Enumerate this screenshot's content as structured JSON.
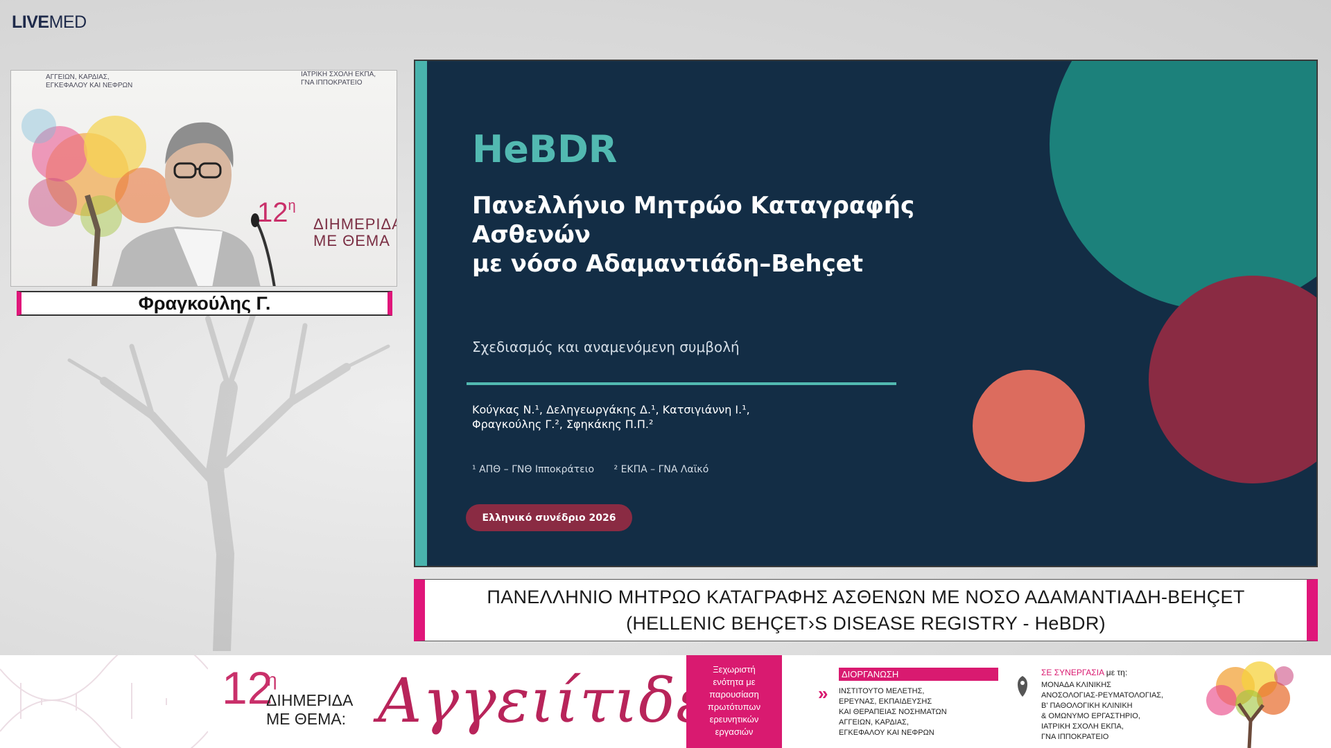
{
  "logo": {
    "bold": "LIVE",
    "light": "MED"
  },
  "video": {
    "org_left": [
      "ΑΓΓΕΙΩΝ, ΚΑΡΔΙΑΣ,",
      "ΕΓΚΕΦΑΛΟΥ ΚΑΙ ΝΕΦΡΩΝ"
    ],
    "org_right": [
      "ΙΑΤΡΙΚΗ ΣΧΟΛΗ ΕΚΠΑ,",
      "ΓΝΑ ΙΠΠΟΚΡΑΤΕΙΟ"
    ],
    "banner_num": "12",
    "banner_sup": "η",
    "banner_lines": [
      "ΔΙΗΜΕΡΙΔΑ",
      "ΜΕ ΘΕΜΑ"
    ]
  },
  "speaker": {
    "name": "Φραγκούλης Γ."
  },
  "slide": {
    "acronym": "HeBDR",
    "title_lines": [
      "Πανελλήνιο Μητρώο Καταγραφής",
      "Ασθενών",
      "με νόσο Αδαμαντιάδη–Behçet"
    ],
    "subtitle": "Σχεδιασμός και αναμενόμενη συμβολή",
    "authors_lines": [
      "Κούγκας Ν.¹, Δεληγεωργάκης Δ.¹, Κατσιγιάννη Ι.¹,",
      "Φραγκούλης Γ.², Σφηκάκης Π.Π.²"
    ],
    "affiliations": [
      "¹ ΑΠΘ – ΓΝΘ Ιπποκράτειο",
      "² ΕΚΠΑ – ΓΝΑ Λαϊκό"
    ],
    "badge": "Ελληνικό συνέδριο 2026",
    "colors": {
      "background": "#132d45",
      "teal": "#52b9b1",
      "maroon": "#8a2b43",
      "coral": "#dc6c5e"
    }
  },
  "caption": {
    "line1": "ΠΑΝΕΛΛΗΝΙΟ ΜΗΤΡΩΟ ΚΑΤΑΓΡΑΦΗΣ ΑΣΘΕΝΩΝ ΜΕ ΝΟΣΟ ΑΔΑΜΑΝΤΙΑΔΗ-BEHÇET",
    "line2": "(HELLENIC BEHÇET›S DISEASE REGISTRY - HeBDR)"
  },
  "banner": {
    "num": "12",
    "sup": "η",
    "lines": [
      "ΔΙΗΜΕΡΙΔΑ",
      "ΜΕ ΘΕΜΑ:"
    ],
    "script_title": "Αγγειίτιδες",
    "pink_box": [
      "Ξεχωριστή",
      "ενότητα με",
      "παρουσίαση",
      "πρωτότυπων",
      "ερευνητικών",
      "εργασιών"
    ],
    "organizer_head": "ΔΙΟΡΓΑΝΩΣΗ",
    "organizer_lines": [
      "ΙΝΣΤΙΤΟΥΤΟ ΜΕΛΕΤΗΣ,",
      "ΕΡΕΥΝΑΣ, ΕΚΠΑΙΔΕΥΣΗΣ",
      "ΚΑΙ ΘΕΡΑΠΕΙΑΣ ΝΟΣΗΜΑΤΩΝ",
      "ΑΓΓΕΙΩΝ, ΚΑΡΔΙΑΣ,",
      "ΕΓΚΕΦΑΛΟΥ ΚΑΙ ΝΕΦΡΩΝ"
    ],
    "collab_head": "ΣΕ ΣΥΝΕΡΓΑΣΙΑ",
    "collab_head_small": " με τη:",
    "collab_lines": [
      "ΜΟΝΑΔΑ ΚΛΙΝΙΚΗΣ",
      "ΑΝΟΣΟΛΟΓΙΑΣ-ΡΕΥΜΑΤΟΛΟΓΙΑΣ,",
      "Β' ΠΑΘΟΛΟΓΙΚΗ ΚΛΙΝΙΚΗ",
      "& ΟΜΩΝΥΜΟ ΕΡΓΑΣΤΗΡΙΟ,",
      "ΙΑΤΡΙΚΗ ΣΧΟΛΗ ΕΚΠΑ,",
      "ΓΝΑ ΙΠΠΟΚΡΑΤΕΙΟ"
    ],
    "accent": "#d91a70"
  }
}
